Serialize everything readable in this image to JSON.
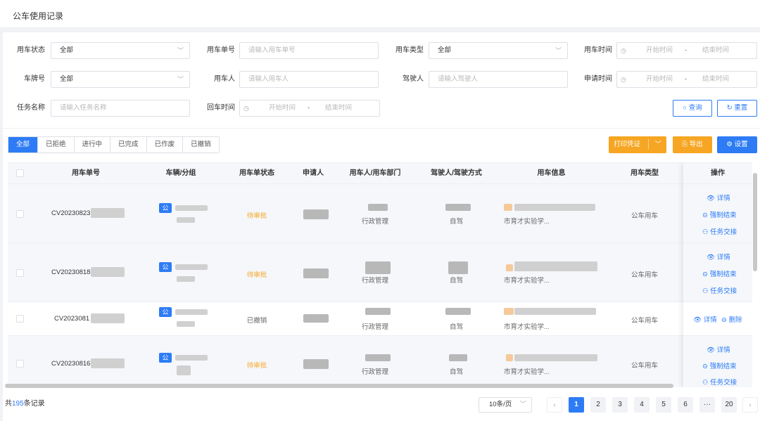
{
  "header": {
    "title": "公车使用记录"
  },
  "filters": {
    "status_label": "用车状态",
    "status_value": "全部",
    "order_label": "用车单号",
    "order_ph": "请输入用车单号",
    "type_label": "用车类型",
    "type_value": "全部",
    "time_label": "用车时间",
    "time_start": "开始时间",
    "time_sep": "-",
    "time_end": "结束时间",
    "plate_label": "车牌号",
    "plate_value": "全部",
    "user_label": "用车人",
    "user_ph": "请输入用车人",
    "driver_label": "驾驶人",
    "driver_ph": "请输入驾驶人",
    "apply_label": "申请时间",
    "apply_start": "开始时间",
    "apply_sep": "-",
    "apply_end": "结束时间",
    "task_label": "任务名称",
    "task_ph": "请输入任务名称",
    "return_label": "回车时间",
    "return_start": "开始时间",
    "return_sep": "-",
    "return_end": "结束时间",
    "query_label": "查询",
    "reset_label": "重置"
  },
  "tabs": [
    "全部",
    "已拒绝",
    "进行中",
    "已完成",
    "已作废",
    "已撤销"
  ],
  "actions": {
    "print_label": "打印凭证",
    "export_label": "导出",
    "settings_label": "设置"
  },
  "table": {
    "headers": [
      "用车单号",
      "车辆/分组",
      "用车单状态",
      "申请人",
      "用车人/用车部门",
      "驾驶人/驾驶方式",
      "用车信息",
      "用车类型",
      "操作"
    ],
    "rows": [
      {
        "order": "CV20230823",
        "badge": "公",
        "status": "待审批",
        "dept": "行政管理",
        "mode": "自驾",
        "info": "市育才实验学...",
        "type": "公车用车",
        "ops": [
          "详情",
          "强制结束",
          "任务交接"
        ]
      },
      {
        "order": "CV20230818",
        "badge": "公",
        "status": "待审批",
        "dept": "行政管理",
        "mode": "自驾",
        "info": "市育才实验学...",
        "type": "公车用车",
        "ops": [
          "详情",
          "强制结束",
          "任务交接"
        ]
      },
      {
        "order": "CV2023081",
        "badge": "公",
        "status": "已撤销",
        "dept": "行政管理",
        "mode": "自驾",
        "info": "市育才实验学...",
        "type": "公车用车",
        "ops": [
          "详情",
          "删除"
        ]
      },
      {
        "order": "CV20230816",
        "badge": "公",
        "status": "待审批",
        "dept": "行政管理",
        "mode": "自驾",
        "info": "市育才实验学...",
        "type": "公车用车",
        "ops": [
          "详情",
          "强制结束",
          "任务交接"
        ]
      }
    ]
  },
  "footer": {
    "total_prefix": "共",
    "total_count": "195",
    "total_suffix": "条记录",
    "page_size": "10条/页",
    "pages": [
      "1",
      "2",
      "3",
      "4",
      "5",
      "6",
      "···",
      "20"
    ]
  },
  "icons": {
    "primary_color": "#2d7cf6",
    "accent_color": "#f6a623"
  }
}
